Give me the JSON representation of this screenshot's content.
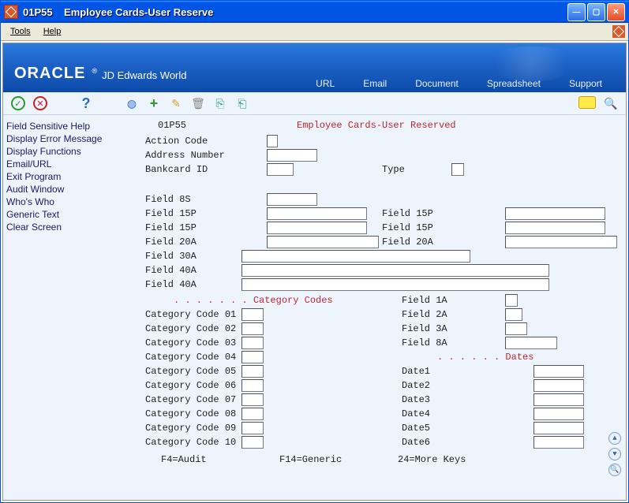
{
  "window": {
    "code": "01P55",
    "title": "Employee Cards-User Reserve"
  },
  "menus": {
    "tools": "Tools",
    "help": "Help"
  },
  "brand": {
    "name": "ORACLE",
    "reg": "®",
    "sub": "JD Edwards World"
  },
  "bannerLinks": {
    "url": "URL",
    "email": "Email",
    "document": "Document",
    "spreadsheet": "Spreadsheet",
    "support": "Support"
  },
  "sidebar": [
    "Field Sensitive Help",
    "Display Error Message",
    "Display Functions",
    "Email/URL",
    "Exit Program",
    "Audit Window",
    "Who's Who",
    "Generic Text",
    "Clear Screen"
  ],
  "header": {
    "screenId": "01P55",
    "title": "Employee Cards-User Reserved"
  },
  "fields": {
    "actionCode": "Action Code",
    "addressNumber": "Address Number",
    "bankcardId": "Bankcard ID",
    "type": "Type",
    "f8s": "Field 8S",
    "f15p": "Field 15P",
    "f20a": "Field 20A",
    "f30a": "Field 30A",
    "f40a": "Field 40A"
  },
  "sections": {
    "cat": ". . . . . . . Category Codes",
    "dates": ". . . . . . Dates"
  },
  "cats": [
    "Category Code 01",
    "Category Code 02",
    "Category Code 03",
    "Category Code 04",
    "Category Code 05",
    "Category Code 06",
    "Category Code 07",
    "Category Code 08",
    "Category Code 09",
    "Category Code 10"
  ],
  "right": {
    "f1a": "Field 1A",
    "f2a": "Field 2A",
    "f3a": "Field 3A",
    "f8a": "Field 8A",
    "d1": "Date1",
    "d2": "Date2",
    "d3": "Date3",
    "d4": "Date4",
    "d5": "Date5",
    "d6": "Date6"
  },
  "footer": {
    "f4": "F4=Audit",
    "f14": "F14=Generic",
    "f24": "24=More Keys"
  }
}
